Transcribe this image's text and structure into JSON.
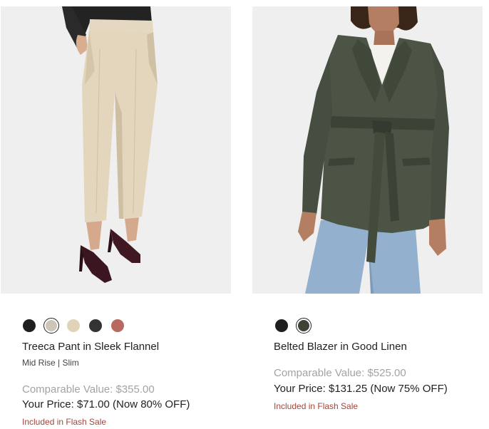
{
  "products": [
    {
      "name": "Treeca Pant in Sleek Flannel",
      "subtitle": "Mid Rise | Slim",
      "comparable_value": "Comparable Value: $355.00",
      "your_price": "Your Price: $71.00 (Now 80% OFF)",
      "flash_label": "Included in Flash Sale",
      "swatches": [
        {
          "color": "#1f1f1f",
          "selected": false
        },
        {
          "color": "#cdc6b6",
          "selected": true
        },
        {
          "color": "#e1d3b8",
          "selected": false
        },
        {
          "color": "#333333",
          "selected": false
        },
        {
          "color": "#b86a60",
          "selected": false
        }
      ]
    },
    {
      "name": "Belted Blazer in Good Linen",
      "subtitle": "",
      "comparable_value": "Comparable Value: $525.00",
      "your_price": "Your Price: $131.25 (Now 75% OFF)",
      "flash_label": "Included in Flash Sale",
      "swatches": [
        {
          "color": "#1f1f1f",
          "selected": false
        },
        {
          "color": "#3d4337",
          "selected": true
        }
      ]
    }
  ],
  "colors": {
    "image_bg": "#efefef",
    "comparable_text": "#a3a3a3",
    "flash_text": "#a2453c"
  }
}
